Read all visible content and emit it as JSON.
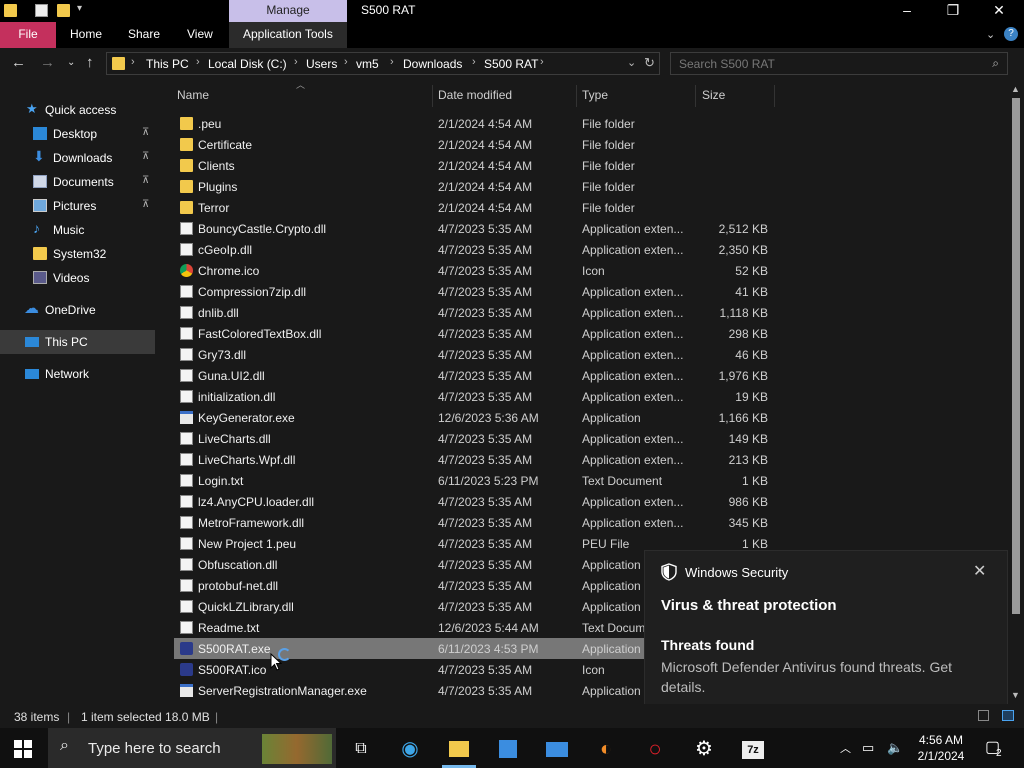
{
  "titlebar": {
    "context_tab": "Manage",
    "window_title": "S500 RAT",
    "minimize": "–",
    "maximize": "❐",
    "close": "✕"
  },
  "ribbon": {
    "tabs": [
      "File",
      "Home",
      "Share",
      "View",
      "Application Tools"
    ]
  },
  "address": {
    "crumbs": [
      "This PC",
      "Local Disk (C:)",
      "Users",
      "vm5",
      "Downloads",
      "S500 RAT"
    ],
    "search_placeholder": "Search S500 RAT"
  },
  "nav": {
    "quick_access": "Quick access",
    "items": [
      {
        "label": "Desktop",
        "pinned": true
      },
      {
        "label": "Downloads",
        "pinned": true
      },
      {
        "label": "Documents",
        "pinned": true
      },
      {
        "label": "Pictures",
        "pinned": true
      },
      {
        "label": "Music",
        "pinned": false
      },
      {
        "label": "System32",
        "pinned": false
      },
      {
        "label": "Videos",
        "pinned": false
      }
    ],
    "onedrive": "OneDrive",
    "this_pc": "This PC",
    "network": "Network",
    "pin_glyph": "📌"
  },
  "columns": {
    "name": "Name",
    "date": "Date modified",
    "type": "Type",
    "size": "Size"
  },
  "files": [
    {
      "name": ".peu",
      "date": "2/1/2024 4:54 AM",
      "type": "File folder",
      "size": "",
      "icon": "folder"
    },
    {
      "name": "Certificate",
      "date": "2/1/2024 4:54 AM",
      "type": "File folder",
      "size": "",
      "icon": "folder"
    },
    {
      "name": "Clients",
      "date": "2/1/2024 4:54 AM",
      "type": "File folder",
      "size": "",
      "icon": "folder"
    },
    {
      "name": "Plugins",
      "date": "2/1/2024 4:54 AM",
      "type": "File folder",
      "size": "",
      "icon": "folder"
    },
    {
      "name": "Terror",
      "date": "2/1/2024 4:54 AM",
      "type": "File folder",
      "size": "",
      "icon": "folder"
    },
    {
      "name": "BouncyCastle.Crypto.dll",
      "date": "4/7/2023 5:35 AM",
      "type": "Application exten...",
      "size": "2,512 KB",
      "icon": "doc"
    },
    {
      "name": "cGeoIp.dll",
      "date": "4/7/2023 5:35 AM",
      "type": "Application exten...",
      "size": "2,350 KB",
      "icon": "doc"
    },
    {
      "name": "Chrome.ico",
      "date": "4/7/2023 5:35 AM",
      "type": "Icon",
      "size": "52 KB",
      "icon": "chrome"
    },
    {
      "name": "Compression7zip.dll",
      "date": "4/7/2023 5:35 AM",
      "type": "Application exten...",
      "size": "41 KB",
      "icon": "doc"
    },
    {
      "name": "dnlib.dll",
      "date": "4/7/2023 5:35 AM",
      "type": "Application exten...",
      "size": "1,118 KB",
      "icon": "doc"
    },
    {
      "name": "FastColoredTextBox.dll",
      "date": "4/7/2023 5:35 AM",
      "type": "Application exten...",
      "size": "298 KB",
      "icon": "doc"
    },
    {
      "name": "Gry73.dll",
      "date": "4/7/2023 5:35 AM",
      "type": "Application exten...",
      "size": "46 KB",
      "icon": "doc"
    },
    {
      "name": "Guna.UI2.dll",
      "date": "4/7/2023 5:35 AM",
      "type": "Application exten...",
      "size": "1,976 KB",
      "icon": "doc"
    },
    {
      "name": "initialization.dll",
      "date": "4/7/2023 5:35 AM",
      "type": "Application exten...",
      "size": "19 KB",
      "icon": "doc"
    },
    {
      "name": "KeyGenerator.exe",
      "date": "12/6/2023 5:36 AM",
      "type": "Application",
      "size": "1,166 KB",
      "icon": "app"
    },
    {
      "name": "LiveCharts.dll",
      "date": "4/7/2023 5:35 AM",
      "type": "Application exten...",
      "size": "149 KB",
      "icon": "doc"
    },
    {
      "name": "LiveCharts.Wpf.dll",
      "date": "4/7/2023 5:35 AM",
      "type": "Application exten...",
      "size": "213 KB",
      "icon": "doc"
    },
    {
      "name": "Login.txt",
      "date": "6/11/2023 5:23 PM",
      "type": "Text Document",
      "size": "1 KB",
      "icon": "doc"
    },
    {
      "name": "lz4.AnyCPU.loader.dll",
      "date": "4/7/2023 5:35 AM",
      "type": "Application exten...",
      "size": "986 KB",
      "icon": "doc"
    },
    {
      "name": "MetroFramework.dll",
      "date": "4/7/2023 5:35 AM",
      "type": "Application exten...",
      "size": "345 KB",
      "icon": "doc"
    },
    {
      "name": "New Project 1.peu",
      "date": "4/7/2023 5:35 AM",
      "type": "PEU File",
      "size": "1 KB",
      "icon": "doc"
    },
    {
      "name": "Obfuscation.dll",
      "date": "4/7/2023 5:35 AM",
      "type": "Application",
      "size": "",
      "icon": "doc"
    },
    {
      "name": "protobuf-net.dll",
      "date": "4/7/2023 5:35 AM",
      "type": "Application",
      "size": "",
      "icon": "doc"
    },
    {
      "name": "QuickLZLibrary.dll",
      "date": "4/7/2023 5:35 AM",
      "type": "Application",
      "size": "",
      "icon": "doc"
    },
    {
      "name": "Readme.txt",
      "date": "12/6/2023 5:44 AM",
      "type": "Text Docum",
      "size": "",
      "icon": "doc"
    },
    {
      "name": "S500RAT.exe",
      "date": "6/11/2023 4:53 PM",
      "type": "Application",
      "size": "",
      "icon": "rat",
      "selected": true
    },
    {
      "name": "S500RAT.ico",
      "date": "4/7/2023 5:35 AM",
      "type": "Icon",
      "size": "",
      "icon": "rat"
    },
    {
      "name": "ServerRegistrationManager.exe",
      "date": "4/7/2023 5:35 AM",
      "type": "Application",
      "size": "",
      "icon": "app"
    }
  ],
  "toast": {
    "source": "Windows Security",
    "title": "Virus & threat protection",
    "subtitle": "Threats found",
    "body": "Microsoft Defender Antivirus found threats. Get details."
  },
  "status": {
    "items_count": "38 items",
    "selection": "1 item selected  18.0 MB"
  },
  "taskbar": {
    "search_placeholder": "Type here to search",
    "time": "4:56 AM",
    "date": "2/1/2024",
    "notification_count": "2"
  }
}
